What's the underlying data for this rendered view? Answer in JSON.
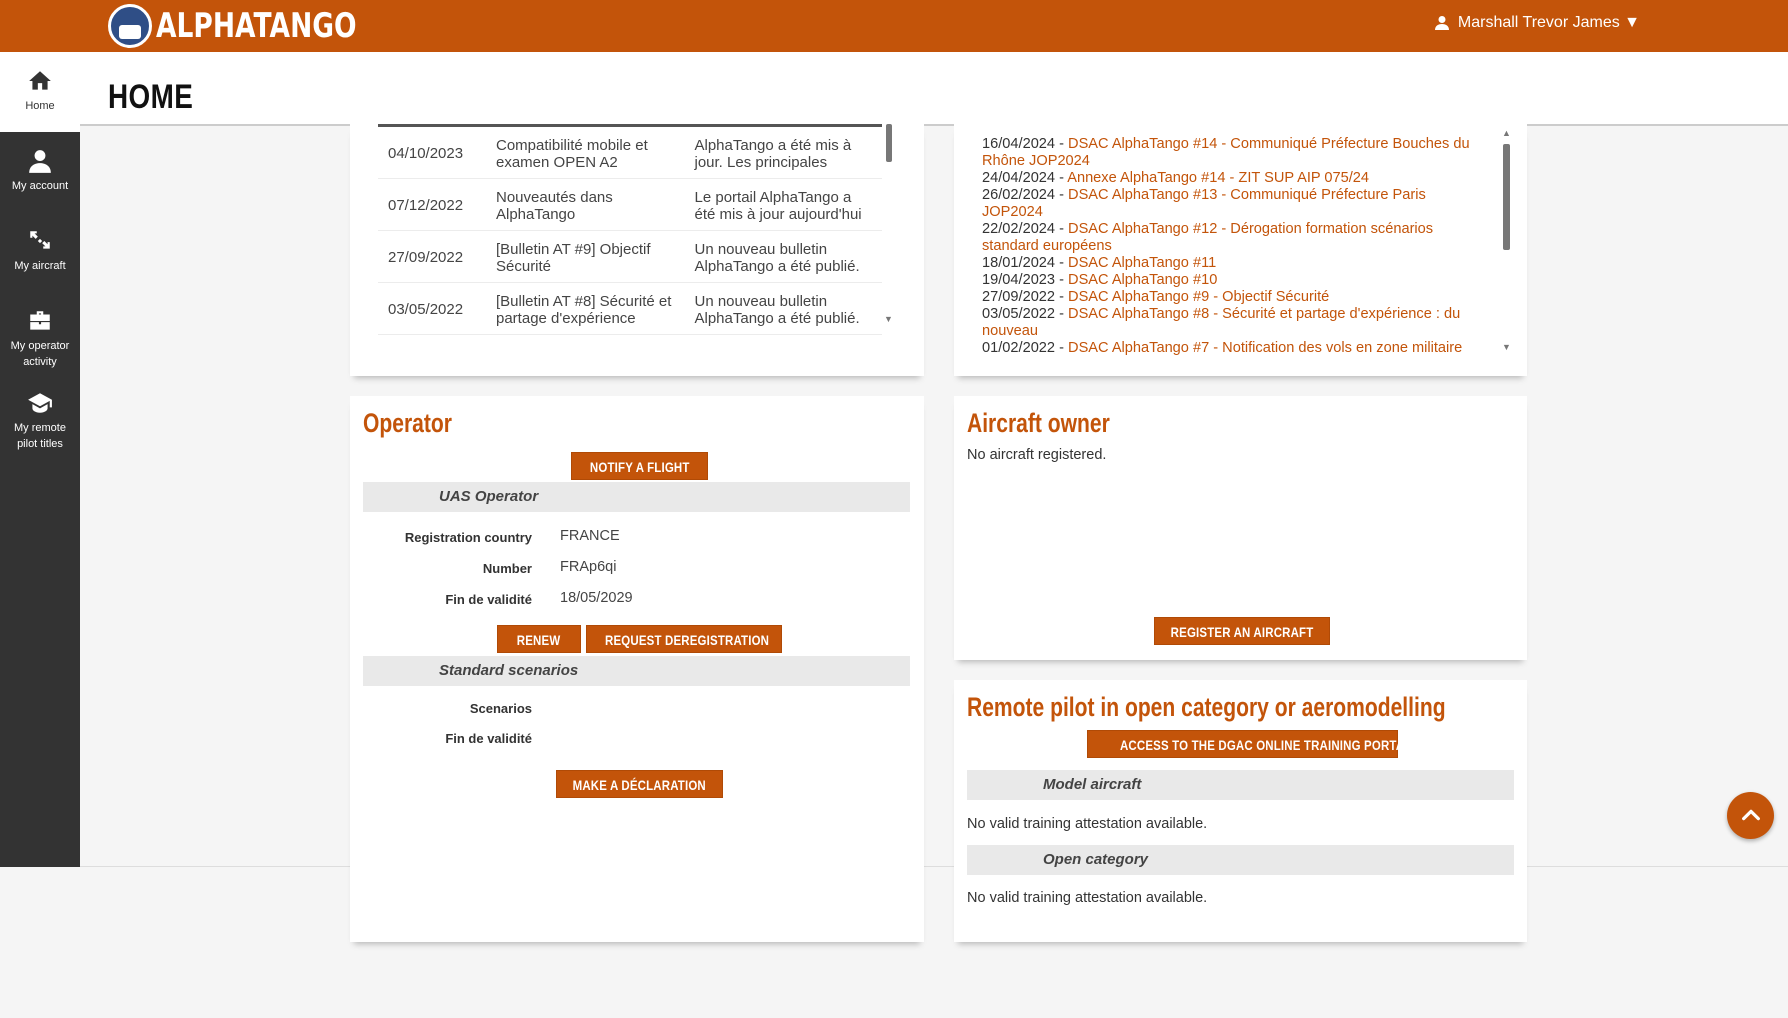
{
  "app": {
    "logo_text": "ALPHATANGO",
    "user_name": "Marshall Trevor James ▼",
    "page_title": "HOME"
  },
  "sidebar": {
    "items": [
      {
        "label": "Home",
        "icon": "home-icon"
      },
      {
        "label": "My account",
        "icon": "user-icon"
      },
      {
        "label": "My aircraft",
        "icon": "drone-icon"
      },
      {
        "label": "My operator activity",
        "icon": "briefcase-icon"
      },
      {
        "label": "My remote pilot titles",
        "icon": "graduation-cap-icon"
      }
    ]
  },
  "news": {
    "rows": [
      {
        "date": "04/10/2023",
        "title": "Compatibilité mobile et examen OPEN A2",
        "summary": "AlphaTango a été mis à jour. Les principales"
      },
      {
        "date": "07/12/2022",
        "title": "Nouveautés dans AlphaTango",
        "summary": "Le portail AlphaTango a été mis à jour aujourd'hui"
      },
      {
        "date": "27/09/2022",
        "title": "[Bulletin AT #9] Objectif Sécurité",
        "summary": "Un nouveau bulletin AlphaTango a été publié."
      },
      {
        "date": "03/05/2022",
        "title": "[Bulletin AT #8] Sécurité et partage d'expérience",
        "summary": "Un nouveau bulletin AlphaTango a été publié."
      }
    ]
  },
  "bulletins": {
    "items": [
      {
        "date": "16/04/2024",
        "title": "DSAC AlphaTango #14 - Communiqué Préfecture Bouches du Rhône JOP2024"
      },
      {
        "date": "24/04/2024",
        "title": "Annexe AlphaTango #14 - ZIT SUP AIP 075/24"
      },
      {
        "date": "26/02/2024",
        "title": "DSAC AlphaTango #13 - Communiqué Préfecture Paris JOP2024"
      },
      {
        "date": "22/02/2024",
        "title": "DSAC AlphaTango #12 - Dérogation formation scénarios standard européens"
      },
      {
        "date": "18/01/2024",
        "title": "DSAC AlphaTango #11"
      },
      {
        "date": "19/04/2023",
        "title": "DSAC AlphaTango #10"
      },
      {
        "date": "27/09/2022",
        "title": "DSAC AlphaTango #9 - Objectif Sécurité"
      },
      {
        "date": "03/05/2022",
        "title": "DSAC AlphaTango #8 - Sécurité et partage d'expérience : du nouveau"
      },
      {
        "date": "01/02/2022",
        "title": "DSAC AlphaTango #7 - Notification des vols en zone militaire"
      }
    ]
  },
  "operator": {
    "title": "Operator",
    "notify_button": "NOTIFY A FLIGHT",
    "uas_section": "UAS Operator",
    "registration_country_label": "Registration country",
    "registration_country": "FRANCE",
    "number_label": "Number",
    "number": "FRAp6qi",
    "validity_label": "Fin de validité",
    "validity": "18/05/2029",
    "renew_button": "RENEW",
    "deregister_button": "REQUEST DEREGISTRATION",
    "scenarios_section": "Standard scenarios",
    "scenarios_label": "Scenarios",
    "scenarios_validity_label": "Fin de validité",
    "declaration_button": "MAKE A DÉCLARATION"
  },
  "owner": {
    "title": "Aircraft owner",
    "empty_text": "No aircraft registered.",
    "register_button": "REGISTER AN AIRCRAFT"
  },
  "pilot": {
    "title": "Remote pilot in open category or aeromodelling",
    "training_button": "ACCESS TO THE DGAC ONLINE TRAINING PORTAL",
    "model_section": "Model aircraft",
    "model_text": "No valid training attestation available.",
    "open_section": "Open category",
    "open_text": "No valid training attestation available."
  },
  "colors": {
    "brand": "#c3540a",
    "sidebar": "#333333"
  }
}
